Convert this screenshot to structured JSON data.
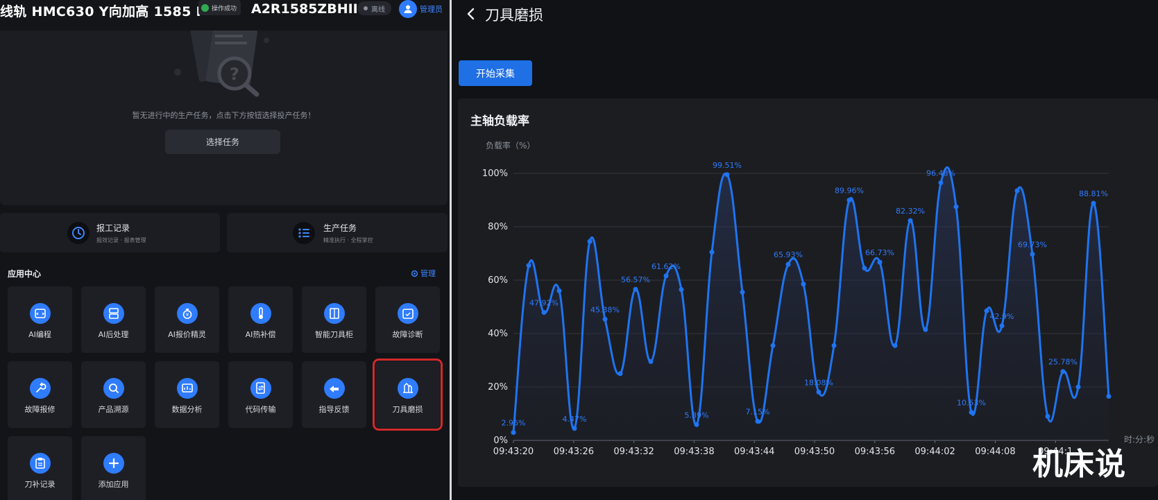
{
  "header": {
    "machine_title": "线轨 HMC630 Y向加高 1585 I",
    "machine_code": "A2R1585ZBHII",
    "toast": "操作成功",
    "status": "离线",
    "user": "管理员"
  },
  "task": {
    "empty_text": "暂无进行中的生产任务，点击下方按钮选择投产任务！",
    "choose_button": "选择任务"
  },
  "quick": [
    {
      "title": "报工记录",
      "subtitle": "报效记录 · 报表管理",
      "icon": "history-icon"
    },
    {
      "title": "生产任务",
      "subtitle": "精准执行 · 全程掌控",
      "icon": "list-icon"
    }
  ],
  "apps": {
    "heading": "应用中心",
    "manage": "管理",
    "items": [
      {
        "label": "AI编程",
        "icon": "code-window-icon"
      },
      {
        "label": "AI后处理",
        "icon": "server-icon"
      },
      {
        "label": "AI报价精灵",
        "icon": "money-bag-icon"
      },
      {
        "label": "AI热补偿",
        "icon": "thermometer-icon"
      },
      {
        "label": "智能刀具柜",
        "icon": "cabinet-icon"
      },
      {
        "label": "故障诊断",
        "icon": "calendar-check-icon"
      },
      {
        "label": "故障报修",
        "icon": "wrench-icon"
      },
      {
        "label": "产品溯源",
        "icon": "magnifier-icon"
      },
      {
        "label": "数据分析",
        "icon": "chart-screen-icon"
      },
      {
        "label": "代码传输",
        "icon": "file-transfer-icon"
      },
      {
        "label": "指导反馈",
        "icon": "feedback-icon"
      },
      {
        "label": "刀具磨损",
        "icon": "tool-wear-icon"
      },
      {
        "label": "刀补记录",
        "icon": "clipboard-icon"
      },
      {
        "label": "添加应用",
        "icon": "plus-icon"
      }
    ]
  },
  "right": {
    "page_title": "刀具磨损",
    "start_button": "开始采集"
  },
  "chart_data": {
    "type": "line",
    "title": "主轴负载率",
    "ylabel": "负载率（%）",
    "xlabel": "时:分:秒",
    "ylim": [
      0,
      100
    ],
    "yticks": [
      "0%",
      "20%",
      "40%",
      "60%",
      "80%",
      "100%"
    ],
    "x_tick_labels": [
      "09:43:20",
      "09:43:26",
      "09:43:32",
      "09:43:38",
      "09:43:44",
      "09:43:50",
      "09:43:56",
      "09:44:02",
      "09:44:08",
      "09:44:1"
    ],
    "grid": true,
    "color": "#1f74f0",
    "values": [
      2.96,
      65.5,
      47.92,
      56.0,
      4.47,
      74.5,
      45.38,
      25.0,
      56.57,
      29.5,
      61.62,
      56.5,
      5.89,
      70.5,
      99.51,
      55.5,
      7.15,
      35.5,
      65.93,
      58.5,
      18.08,
      35.5,
      89.96,
      64.5,
      66.73,
      35.5,
      82.32,
      41.5,
      96.48,
      87.5,
      10.53,
      48.5,
      42.9,
      93.5,
      69.73,
      9.0,
      25.78,
      20.0,
      88.81,
      16.5
    ],
    "data_labels": [
      {
        "index": 0,
        "text": "2.96%"
      },
      {
        "index": 2,
        "text": "47.92%"
      },
      {
        "index": 4,
        "text": "4.47%"
      },
      {
        "index": 6,
        "text": "45.38%"
      },
      {
        "index": 8,
        "text": "56.57%"
      },
      {
        "index": 10,
        "text": "61.62%"
      },
      {
        "index": 12,
        "text": "5.89%"
      },
      {
        "index": 14,
        "text": "99.51%"
      },
      {
        "index": 16,
        "text": "7.15%"
      },
      {
        "index": 18,
        "text": "65.93%"
      },
      {
        "index": 20,
        "text": "18.08%"
      },
      {
        "index": 22,
        "text": "89.96%"
      },
      {
        "index": 24,
        "text": "66.73%"
      },
      {
        "index": 26,
        "text": "82.32%"
      },
      {
        "index": 28,
        "text": "96.48%"
      },
      {
        "index": 30,
        "text": "10.53%"
      },
      {
        "index": 32,
        "text": "42.9%"
      },
      {
        "index": 34,
        "text": "69.73%"
      },
      {
        "index": 36,
        "text": "25.78%"
      },
      {
        "index": 38,
        "text": "88.81%"
      }
    ]
  },
  "watermark": "机床说"
}
